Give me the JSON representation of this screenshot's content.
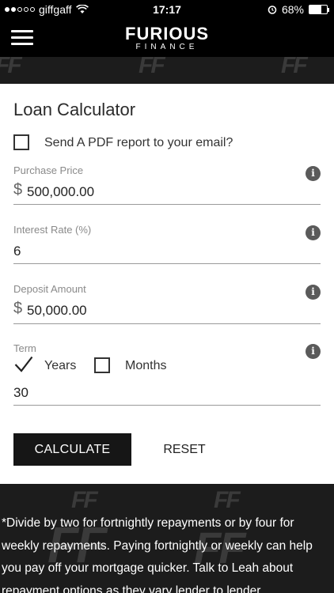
{
  "status_bar": {
    "carrier": "giffgaff",
    "time": "17:17",
    "battery": "68%",
    "battery_level": 0.68
  },
  "header": {
    "brand_name": "FURIOUS",
    "brand_sub": "FINANCE"
  },
  "watermark_text": "FF",
  "calculator": {
    "title": "Loan Calculator",
    "pdf_checkbox_label": "Send A PDF report to your email?",
    "fields": {
      "purchase_price": {
        "label": "Purchase Price",
        "currency": "$",
        "value": "500,000.00"
      },
      "interest_rate": {
        "label": "Interest Rate (%)",
        "value": "6"
      },
      "deposit_amount": {
        "label": "Deposit Amount",
        "currency": "$",
        "value": "50,000.00"
      },
      "term": {
        "label": "Term",
        "years_label": "Years",
        "months_label": "Months",
        "value": "30"
      }
    },
    "info_glyph": "i",
    "calculate_label": "CALCULATE",
    "reset_label": "RESET"
  },
  "disclaimer": "*Divide by two for fortnightly repayments or by four for weekly repayments. Paying fortnightly or weekly can help you pay off your mortgage quicker. Talk to Leah about repayment options as they vary lender to lender."
}
